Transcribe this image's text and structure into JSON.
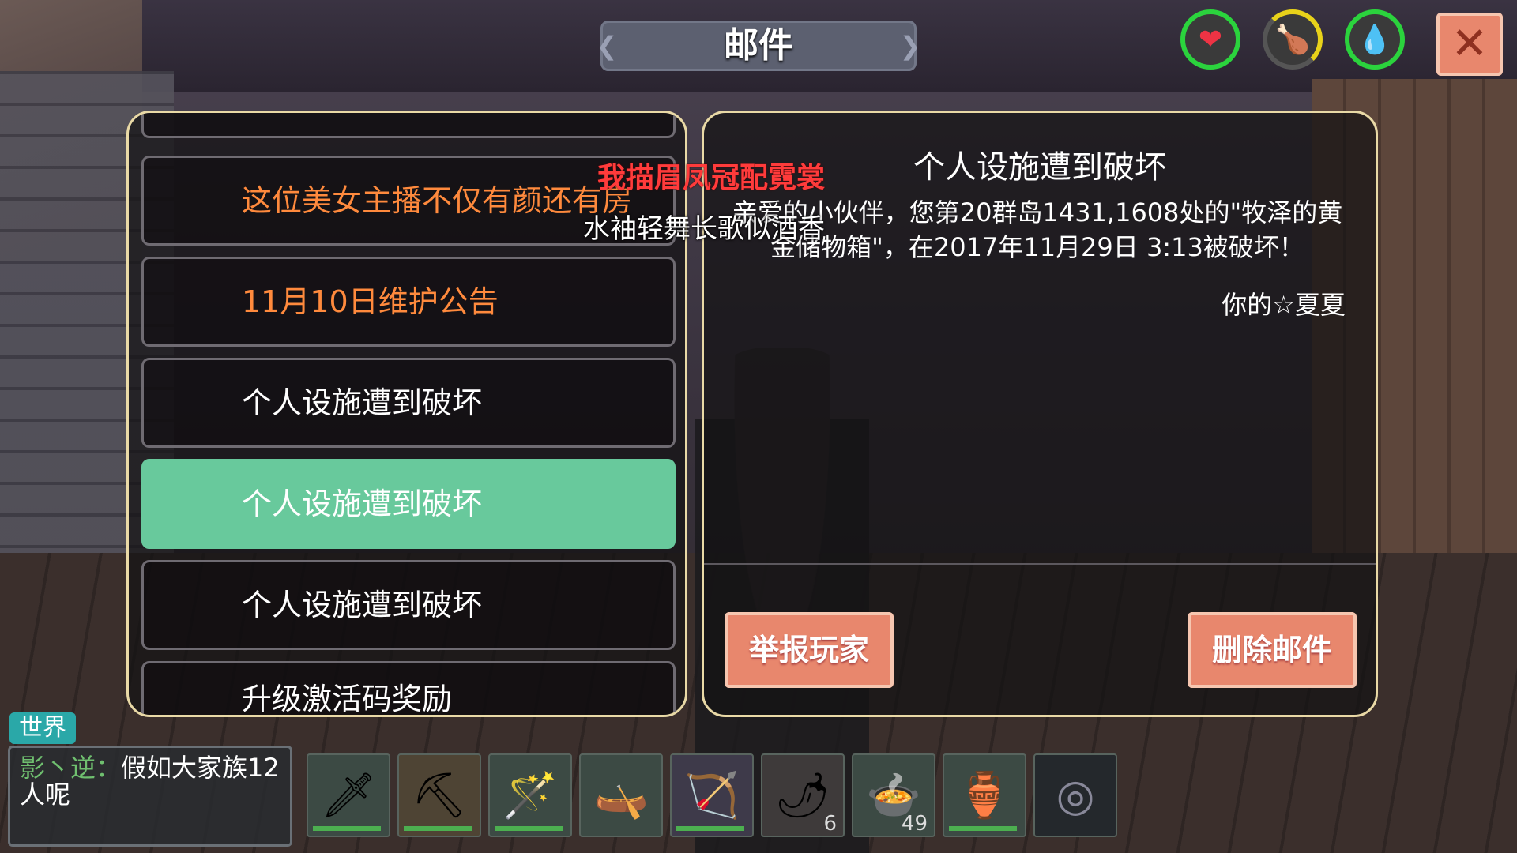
{
  "title": "邮件",
  "stats": {
    "heart_icon": "heart-icon",
    "food_icon": "drumstick-icon",
    "water_icon": "water-drop-icon"
  },
  "close_label": "✕",
  "mail_list": {
    "items": [
      {
        "label": "",
        "style": "partial-top"
      },
      {
        "label": "这位美女主播不仅有颜还有房",
        "style": "orange"
      },
      {
        "label": "11月10日维护公告",
        "style": "orange"
      },
      {
        "label": "个人设施遭到破坏",
        "style": "normal"
      },
      {
        "label": "个人设施遭到破坏",
        "style": "active"
      },
      {
        "label": "个人设施遭到破坏",
        "style": "normal"
      },
      {
        "label": "升级激活码奖励",
        "style": "partial-bottom"
      }
    ]
  },
  "overlays": {
    "red_text": "我描眉凤冠配霓裳",
    "white_text": "水袖轻舞长歌似酒香"
  },
  "mail_detail": {
    "title": "个人设施遭到破坏",
    "body": "亲爱的小伙伴，您第20群岛1431,1608处的\"牧泽的黄金储物箱\"，在2017年11月29日 3:13被破坏！",
    "signature": "你的☆夏夏",
    "report_button": "举报玩家",
    "delete_button": "删除邮件"
  },
  "chat": {
    "tab_label": "世界",
    "sender": "影丶逆：",
    "message": "假如大家族12人呢"
  },
  "hotbar": {
    "slots": [
      {
        "icon": "ice-sword-icon",
        "symbol": "🗡",
        "count": ""
      },
      {
        "icon": "pickaxe-icon",
        "symbol": "⛏",
        "count": ""
      },
      {
        "icon": "magic-staff-icon",
        "symbol": "🪄",
        "count": ""
      },
      {
        "icon": "wooden-boat-icon",
        "symbol": "🛶",
        "count": ""
      },
      {
        "icon": "crossbow-icon",
        "symbol": "🏹",
        "count": ""
      },
      {
        "icon": "chili-pepper-icon",
        "symbol": "🌶",
        "count": "6"
      },
      {
        "icon": "soup-bowl-icon",
        "symbol": "🍲",
        "count": "49"
      },
      {
        "icon": "gourd-flask-icon",
        "symbol": "🏺",
        "count": ""
      },
      {
        "icon": "discus-icon",
        "symbol": "◎",
        "count": ""
      }
    ]
  },
  "colors": {
    "accent_green": "#68c99c",
    "button_salmon": "#e8876d",
    "orange_text": "#ff8a3d",
    "panel_border": "#e9d9a6"
  }
}
